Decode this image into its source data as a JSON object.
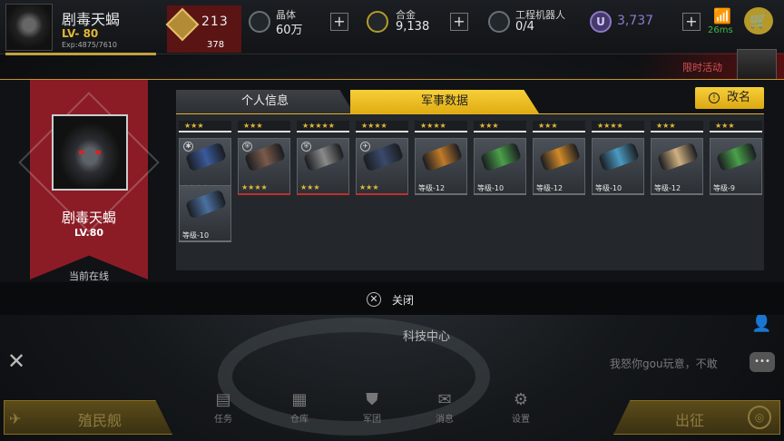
{
  "header": {
    "player_name": "剧毒天蝎",
    "level": "LV- 80",
    "exp": "Exp:4875/7610",
    "rank_icon": "rank-medal-icon",
    "podium_digits": "213",
    "rank_value": "378",
    "resources": [
      {
        "label": "晶体",
        "value": "60万",
        "icon": "crystal-icon"
      },
      {
        "label": "合金",
        "value": "9,138",
        "icon": "alloy-icon"
      },
      {
        "label": "工程机器人",
        "value": "0/4",
        "icon": "robot-icon"
      }
    ],
    "premium_symbol": "U",
    "premium_value": "3,737",
    "ping": "26ms",
    "promo_label": "限时活动"
  },
  "profile": {
    "name": "剧毒天蝎",
    "level": "LV.80",
    "status": "当前在线",
    "accent_color": "#8b1c26"
  },
  "tabs": [
    {
      "label": "个人信息",
      "active": false
    },
    {
      "label": "军事数据",
      "active": true
    }
  ],
  "rename_label": "改名",
  "items": [
    {
      "rarity": "★★★",
      "badge": "✱",
      "bottom": "★★★★",
      "type": "stars",
      "art": "#3a5a9a"
    },
    {
      "rarity": "★★★",
      "badge": "⛨",
      "bottom": "★★★★",
      "type": "stars",
      "art": "#7a5a4a"
    },
    {
      "rarity": "★★★★★",
      "badge": "⛨",
      "bottom": "★★★",
      "type": "stars",
      "art": "#8a8a8a"
    },
    {
      "rarity": "★★★★",
      "badge": "✈",
      "bottom": "★★★",
      "type": "stars",
      "art": "#3a4a6a"
    },
    {
      "rarity": "★★★★",
      "badge": "",
      "bottom": "等级-12",
      "type": "level",
      "art": "#c07a2a"
    },
    {
      "rarity": "★★★",
      "badge": "",
      "bottom": "等级-10",
      "type": "level",
      "art": "#4aa04a"
    },
    {
      "rarity": "★★★",
      "badge": "",
      "bottom": "等级-12",
      "type": "level",
      "art": "#d08a2a"
    },
    {
      "rarity": "★★★★",
      "badge": "",
      "bottom": "等级-10",
      "type": "level",
      "art": "#4a9ac0"
    },
    {
      "rarity": "★★★",
      "badge": "",
      "bottom": "等级-12",
      "type": "level",
      "art": "#d0b080"
    },
    {
      "rarity": "★★★",
      "badge": "",
      "bottom": "等级-9",
      "type": "level",
      "art": "#4aa04a"
    },
    {
      "rarity": "",
      "badge": "",
      "bottom": "等级-10",
      "type": "level",
      "art": "#4a70a0"
    }
  ],
  "close_label": "关闭",
  "scene": {
    "tech_center": "科技中心",
    "chat_text": "我怒你gou玩意，不敢"
  },
  "bottom_nav": {
    "colony_label": "殖民舰",
    "deploy_label": "出征",
    "items": [
      {
        "label": "任务",
        "icon": "mission-icon"
      },
      {
        "label": "仓库",
        "icon": "warehouse-icon"
      },
      {
        "label": "军团",
        "icon": "legion-icon"
      },
      {
        "label": "消息",
        "icon": "mail-icon"
      },
      {
        "label": "设置",
        "icon": "gear-icon"
      }
    ]
  }
}
